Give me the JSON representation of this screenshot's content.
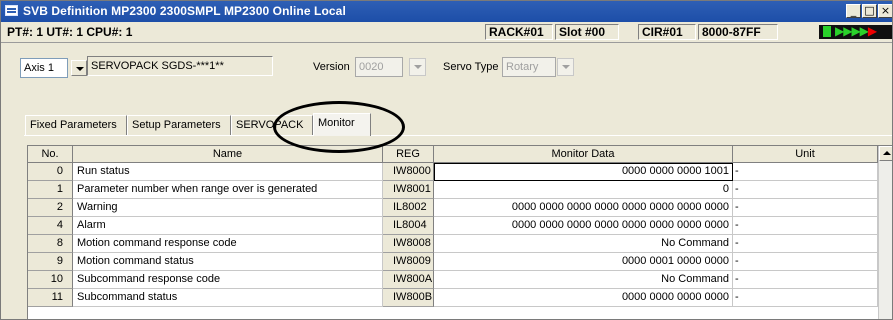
{
  "window": {
    "title": "SVB Definition  MP2300  2300SMPL  MP2300   Online  Local",
    "minimize": "_",
    "maximize": "□",
    "close": "×"
  },
  "infobar": {
    "location": "PT#: 1  UT#: 1  CPU#: 1",
    "rack": "RACK#01",
    "slot": "Slot #00",
    "cir": "CIR#01",
    "address_range": "8000-87FF",
    "status_colors": {
      "lamp": "#2ad12a",
      "arrows": "#2ad12a",
      "arrows_alert": "#e00000"
    }
  },
  "axis": {
    "selected": "Axis 1",
    "servopack": "SERVOPACK SGDS-***1**",
    "version_label": "Version",
    "version_value": "0020",
    "servo_type_label": "Servo Type",
    "servo_type_value": "Rotary"
  },
  "tabs": [
    {
      "label": "Fixed Parameters"
    },
    {
      "label": "Setup Parameters"
    },
    {
      "label": "SERVOPACK"
    },
    {
      "label": "Monitor"
    }
  ],
  "table": {
    "headers": {
      "no": "No.",
      "name": "Name",
      "reg": "REG",
      "data": "Monitor Data",
      "unit": "Unit"
    },
    "rows": [
      {
        "no": "0",
        "name": "Run status",
        "reg": "IW8000",
        "data": "0000 0000 0000 1001",
        "unit": "-"
      },
      {
        "no": "1",
        "name": "Parameter number when range over is generated",
        "reg": "IW8001",
        "data": "0",
        "unit": "-"
      },
      {
        "no": "2",
        "name": "Warning",
        "reg": "IL8002",
        "data": "0000 0000 0000 0000 0000 0000 0000 0000",
        "unit": "-"
      },
      {
        "no": "4",
        "name": "Alarm",
        "reg": "IL8004",
        "data": "0000 0000 0000 0000 0000 0000 0000 0000",
        "unit": "-"
      },
      {
        "no": "8",
        "name": "Motion command response code",
        "reg": "IW8008",
        "data": "No Command",
        "unit": "-"
      },
      {
        "no": "9",
        "name": "Motion command status",
        "reg": "IW8009",
        "data": "0000 0001 0000 0000",
        "unit": "-"
      },
      {
        "no": "10",
        "name": "Subcommand response code",
        "reg": "IW800A",
        "data": "No Command",
        "unit": "-"
      },
      {
        "no": "11",
        "name": "Subcommand status",
        "reg": "IW800B",
        "data": "0000 0000 0000 0000",
        "unit": "-"
      }
    ]
  }
}
